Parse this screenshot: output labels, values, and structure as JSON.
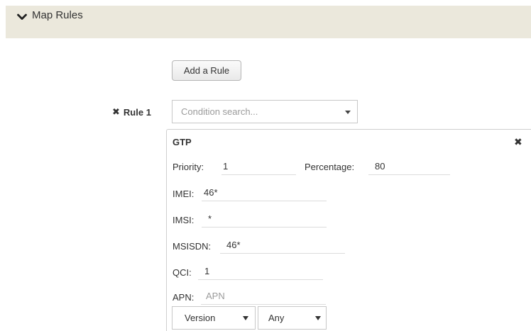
{
  "section": {
    "title": "Map Rules",
    "icon": "chevron-down-icon"
  },
  "add_rule_button": "Add a Rule",
  "rule": {
    "label": "Rule 1",
    "remove_icon": "close-icon"
  },
  "condition_search": {
    "placeholder": "Condition search..."
  },
  "gtp": {
    "title": "GTP",
    "close_icon": "close-icon",
    "priority": {
      "label": "Priority:",
      "value": "1"
    },
    "percentage": {
      "label": "Percentage:",
      "value": "80"
    },
    "imei": {
      "label": "IMEI:",
      "value": "46*"
    },
    "imsi": {
      "label": "IMSI:",
      "value": "*"
    },
    "msisdn": {
      "label": "MSISDN:",
      "value": "46*"
    },
    "qci": {
      "label": "QCI:",
      "value": "1"
    },
    "apn": {
      "label": "APN:",
      "placeholder": "APN"
    },
    "version_select": {
      "value": "Version"
    },
    "any_select": {
      "value": "Any"
    }
  }
}
